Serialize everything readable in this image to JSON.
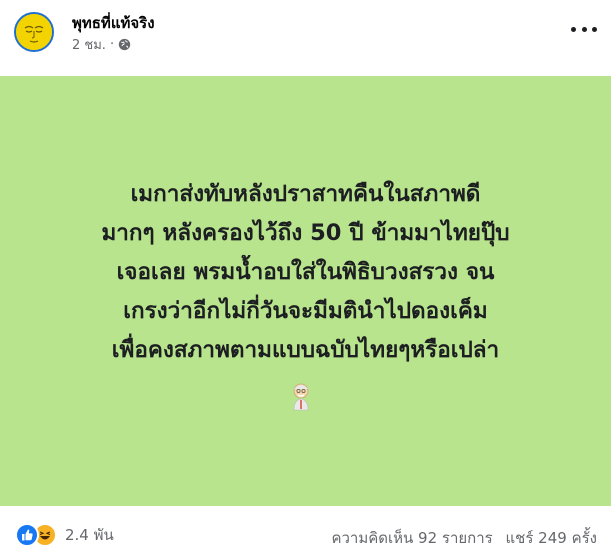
{
  "post": {
    "author": "พุทธที่แท้จริง",
    "timestamp": "2 ชม.",
    "separator": "·",
    "privacy_icon": "globe-icon",
    "more_icon": "more-options-icon",
    "background_color": "#b7e48c",
    "text_lines": [
      "เมกาส่งทับหลังปราสาทคืนในสภาพดี",
      "มากๆ หลังครองไว้ถึง 50 ปี ข้ามมาไทยปุ๊บ",
      "เจอเลย พรมน้ำอบใส่ในพิธิบวงสรวง จน",
      "เกรงว่าอีกไม่กี่วันจะมีมตินำไปดองเค็ม",
      "เพื่อคงสภาพตามแบบฉบับไทยๆหรือเปล่า"
    ],
    "emoji": "old-man-emoji"
  },
  "footer": {
    "reaction_icons": [
      "like-icon",
      "haha-icon"
    ],
    "reaction_count": "2.4 พัน",
    "comments": "ความคิดเห็น 92 รายการ",
    "shares": "แชร์ 249 ครั้ง"
  }
}
